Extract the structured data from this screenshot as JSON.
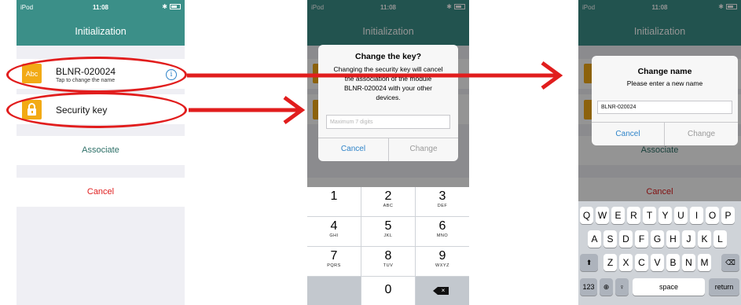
{
  "status": {
    "carrier": "iPod",
    "time": "11:08",
    "bluetooth": "✱"
  },
  "nav_title": "Initialization",
  "device": {
    "name": "BLNR-020024",
    "subtitle": "Tap to change the name",
    "icon_label": "Abc"
  },
  "security_label": "Security key",
  "associate_label": "Associate",
  "cancel_label": "Cancel",
  "info_glyph": "i",
  "change_key_alert": {
    "title": "Change the key?",
    "message_lines": [
      "Changing the security key will cancel",
      "the association of the module",
      "BLNR-020024 with your other",
      "devices."
    ],
    "placeholder": "Maximum 7 digits",
    "cancel": "Cancel",
    "confirm": "Change"
  },
  "numpad": [
    {
      "num": "1",
      "letters": ""
    },
    {
      "num": "2",
      "letters": "ABC"
    },
    {
      "num": "3",
      "letters": "DEF"
    },
    {
      "num": "4",
      "letters": "GHI"
    },
    {
      "num": "5",
      "letters": "JKL"
    },
    {
      "num": "6",
      "letters": "MNO"
    },
    {
      "num": "7",
      "letters": "PQRS"
    },
    {
      "num": "8",
      "letters": "TUV"
    },
    {
      "num": "9",
      "letters": "WXYZ"
    },
    {
      "num": "0",
      "letters": ""
    }
  ],
  "change_name_alert": {
    "title": "Change name",
    "message": "Please enter a new name",
    "value": "BLNR-020024",
    "cancel": "Cancel",
    "confirm": "Change"
  },
  "keyboard": {
    "row1": [
      "Q",
      "W",
      "E",
      "R",
      "T",
      "Y",
      "U",
      "I",
      "O",
      "P"
    ],
    "row2": [
      "A",
      "S",
      "D",
      "F",
      "G",
      "H",
      "J",
      "K",
      "L"
    ],
    "row3": [
      "Z",
      "X",
      "C",
      "V",
      "B",
      "N",
      "M"
    ],
    "num_key": "123",
    "space": "space",
    "return": "return"
  },
  "colors": {
    "accent": "#3b8f88",
    "icon": "#f2aa15",
    "annotation": "#e11d1d",
    "link": "#2f84c9",
    "cancel": "#e02020"
  }
}
